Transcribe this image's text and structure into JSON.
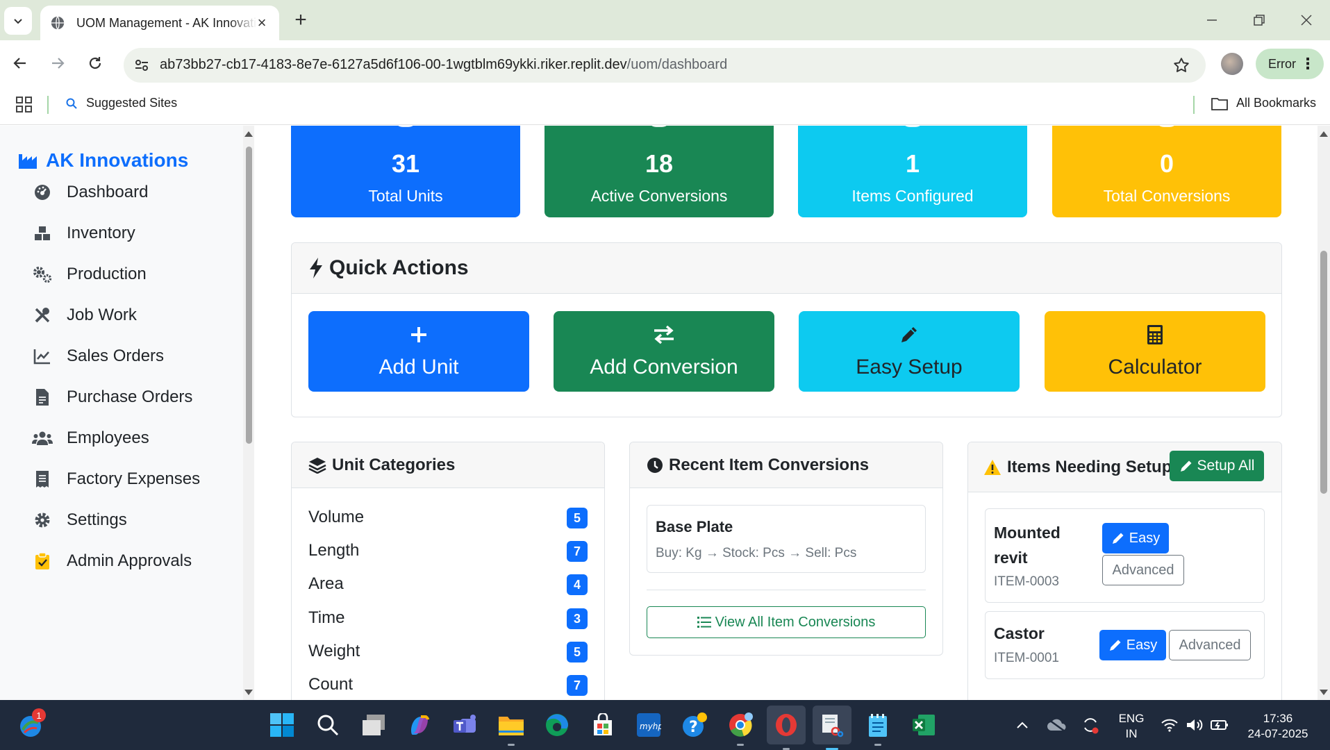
{
  "browser": {
    "tab_title": "UOM Management - AK Innovations",
    "url_host": "ab73bb27-cb17-4183-8e7e-6127a5d6f106-00-1wgtblm69ykki.riker.replit.dev",
    "url_path": "/uom/dashboard",
    "profile_status": "Error",
    "bookmarks": {
      "suggested": "Suggested Sites",
      "all": "All Bookmarks"
    }
  },
  "sidebar": {
    "brand": "AK Innovations",
    "items": [
      {
        "label": "Dashboard",
        "icon": "dashboard-icon"
      },
      {
        "label": "Inventory",
        "icon": "boxes-icon"
      },
      {
        "label": "Production",
        "icon": "cogs-icon"
      },
      {
        "label": "Job Work",
        "icon": "tools-icon"
      },
      {
        "label": "Sales Orders",
        "icon": "chart-line-icon"
      },
      {
        "label": "Purchase Orders",
        "icon": "file-invoice-icon"
      },
      {
        "label": "Employees",
        "icon": "users-icon"
      },
      {
        "label": "Factory Expenses",
        "icon": "receipt-icon"
      },
      {
        "label": "Settings",
        "icon": "gear-icon"
      },
      {
        "label": "Admin Approvals",
        "icon": "clipboard-check-icon"
      }
    ]
  },
  "stats": [
    {
      "value": "31",
      "label": "Total Units",
      "color": "#0d6efd"
    },
    {
      "value": "18",
      "label": "Active Conversions",
      "color": "#198754"
    },
    {
      "value": "1",
      "label": "Items Configured",
      "color": "#0dcaf0"
    },
    {
      "value": "0",
      "label": "Total Conversions",
      "color": "#ffc107"
    }
  ],
  "quick_actions": {
    "title": "Quick Actions",
    "buttons": [
      {
        "label": "Add Unit",
        "icon": "plus-icon",
        "color": "#0d6efd"
      },
      {
        "label": "Add Conversion",
        "icon": "exchange-icon",
        "color": "#198754"
      },
      {
        "label": "Easy Setup",
        "icon": "pencil-icon",
        "color": "#0dcaf0"
      },
      {
        "label": "Calculator",
        "icon": "calculator-icon",
        "color": "#ffc107"
      }
    ]
  },
  "unit_categories": {
    "title": "Unit Categories",
    "rows": [
      {
        "name": "Volume",
        "count": "5"
      },
      {
        "name": "Length",
        "count": "7"
      },
      {
        "name": "Area",
        "count": "4"
      },
      {
        "name": "Time",
        "count": "3"
      },
      {
        "name": "Weight",
        "count": "5"
      },
      {
        "name": "Count",
        "count": "7"
      }
    ]
  },
  "recent_conversions": {
    "title": "Recent Item Conversions",
    "item_name": "Base Plate",
    "item_flow": "Buy: Kg → Stock: Pcs → Sell: Pcs",
    "view_all": "View All Item Conversions"
  },
  "needing_setup": {
    "title": "Items Needing Setup",
    "setup_all": "Setup All",
    "items": [
      {
        "name": "Mounted revit",
        "code": "ITEM-0003",
        "easy": "Easy",
        "advanced": "Advanced"
      },
      {
        "name": "Castor",
        "code": "ITEM-0001",
        "easy": "Easy",
        "advanced": "Advanced"
      }
    ]
  },
  "taskbar": {
    "lang_1": "ENG",
    "lang_2": "IN",
    "time": "17:36",
    "date": "24-07-2025",
    "notification_count": "1"
  }
}
